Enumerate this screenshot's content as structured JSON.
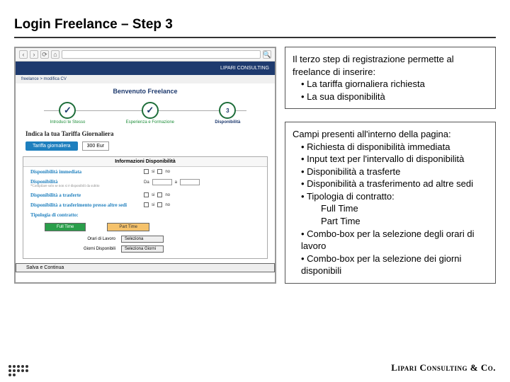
{
  "title": "Login Freelance – Step 3",
  "mockup": {
    "banner_brand": "LIPARI CONSULTING",
    "breadcrumb": "freelance > modifica CV",
    "welcome": "Benvenuto Freelance",
    "steps": {
      "s1": "Introduci te Stesso",
      "s2": "Esperienza e Formazione",
      "s3_num": "3",
      "s3": "Disponibilità"
    },
    "tariff_heading": "Indica la tua Tariffa Giornaliera",
    "tariff_label": "Tariffa giornaliera",
    "tariff_value": "300 Eur",
    "info_box_title": "Informazioni Disponibilità",
    "row_immediate": "Disponibilità immediata",
    "row_avail": "Disponibilità",
    "row_avail_sub": "*Compilare solo se non si è disponibili da subito",
    "row_avail_da": "Da",
    "row_avail_a": "a",
    "row_trasf": "Disponibilità a trasferte",
    "row_sede": "Disponibilità a trasferimento presso altre sedi",
    "row_tipologia": "Tipologia di contratto:",
    "opt_si": "si",
    "opt_no": "no",
    "btn_full": "Full Time",
    "btn_part": "Part Time",
    "lbl_orari": "Orari di Lavoro",
    "sel_orari": "Seleziona",
    "lbl_giorni": "Giorni Disponibili",
    "sel_giorni": "Seleziona Giorni",
    "save": "Salva e Continua"
  },
  "box1": {
    "intro": "Il terzo step di registrazione permette al freelance di inserire:",
    "b1": "La tariffa giornaliera richiesta",
    "b2": "La sua disponibilità"
  },
  "box2": {
    "intro": "Campi presenti all'interno della pagina:",
    "b1": "Richiesta di disponibilità immediata",
    "b2": "Input text per l'intervallo di disponibilità",
    "b3": "Disponibilità a trasferte",
    "b4": "Disponibilità a trasferimento ad altre sedi",
    "b5": "Tipologia di contratto:",
    "b5a": "Full Time",
    "b5b": "Part Time",
    "b6": "Combo-box per la selezione degli orari di lavoro",
    "b7": "Combo-box per la selezione dei giorni disponibili"
  },
  "brand": "Lipari Consulting & Co."
}
